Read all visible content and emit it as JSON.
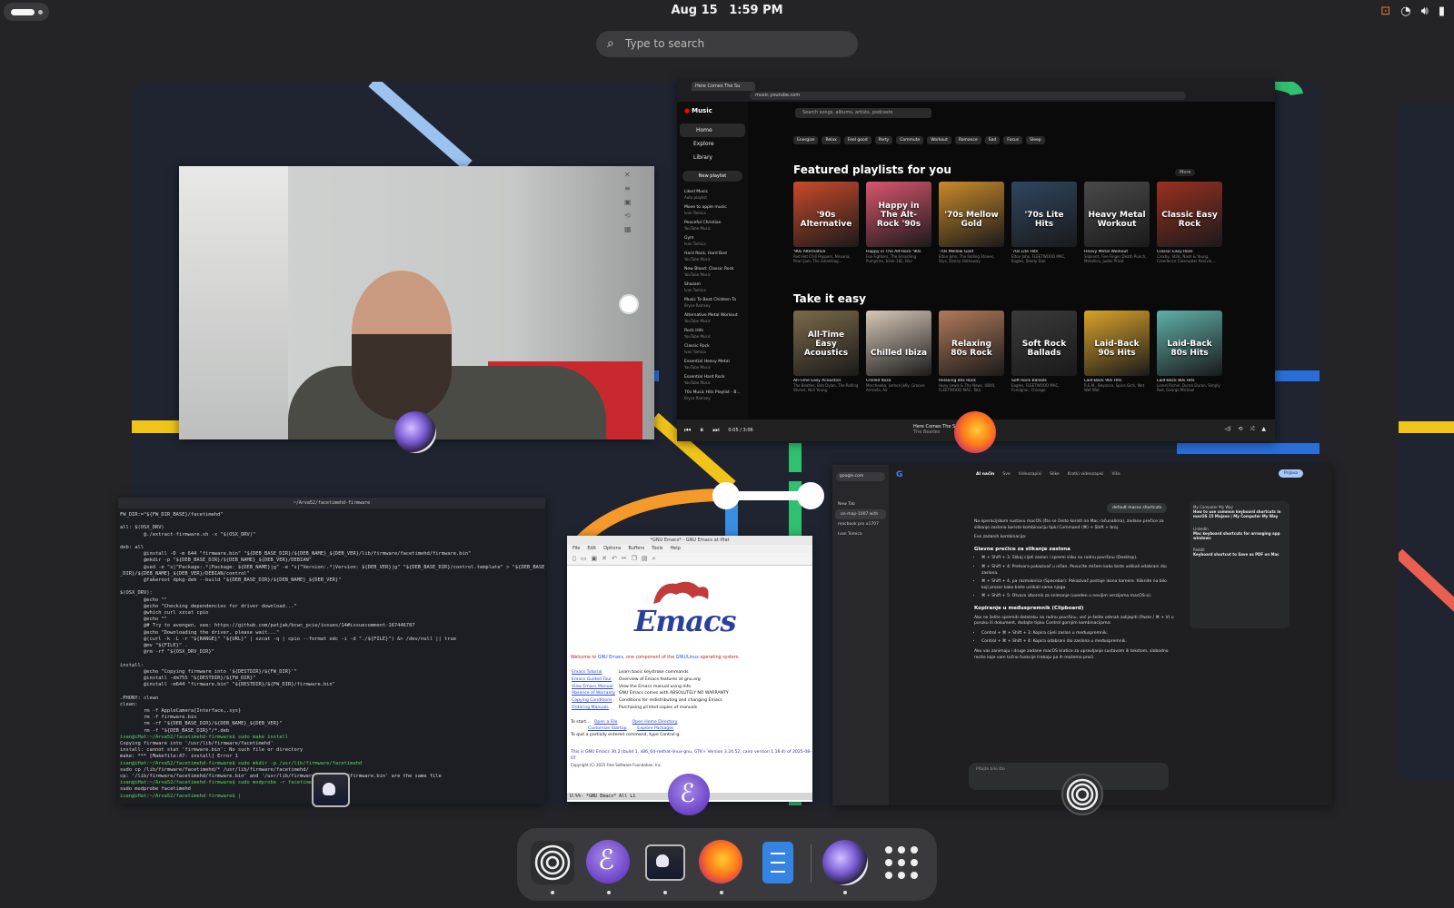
{
  "topbar": {
    "date": "Aug 15",
    "time": "1:59 PM"
  },
  "search": {
    "placeholder": "Type to search"
  },
  "windows": {
    "youtube_music": {
      "tab_title": "Here Comes The Su",
      "url": "music.youtube.com",
      "nav": [
        "Home",
        "Explore",
        "Library"
      ],
      "new_playlist": "New playlist",
      "playlists": [
        {
          "name": "Liked Music",
          "sub": "Auto playlist"
        },
        {
          "name": "Move to apple music",
          "sub": "Ivan Tomica"
        },
        {
          "name": "Peaceful Christian",
          "sub": "YouTube Music"
        },
        {
          "name": "Gym",
          "sub": "Ivan Tomica"
        },
        {
          "name": "Hard Rock, Hard Bod",
          "sub": "YouTube Music"
        },
        {
          "name": "New Blood: Classic Rock",
          "sub": "YouTube Music"
        },
        {
          "name": "Shazam",
          "sub": "Ivan Tomica"
        },
        {
          "name": "Music To Beat Children To",
          "sub": "Bryce Ramsey"
        },
        {
          "name": "Alternative Metal Workout",
          "sub": "YouTube Music"
        },
        {
          "name": "Rock Hits",
          "sub": "YouTube Music"
        },
        {
          "name": "Classic Rock",
          "sub": "Ivan Tomica"
        },
        {
          "name": "Essential Heavy Metal",
          "sub": "YouTube Music"
        },
        {
          "name": "Essential Hard Rock",
          "sub": "YouTube Music"
        },
        {
          "name": "70s Music Hits Playlist - B...",
          "sub": "Bryce Ramsey"
        }
      ],
      "search_placeholder": "Search songs, albums, artists, podcasts",
      "moods": [
        "Energize",
        "Relax",
        "Feel good",
        "Party",
        "Commute",
        "Workout",
        "Romance",
        "Sad",
        "Focus",
        "Sleep"
      ],
      "section1_title": "Featured playlists for you",
      "more_label": "More",
      "featured": [
        {
          "art": "'90s Alternative",
          "title": "'90s Alternative",
          "sub": "Red Hot Chili Peppers, Nirvana, Pearl Jam, The Smashing...",
          "color": "#c94a2a"
        },
        {
          "art": "Happy in The Alt-Rock '90s",
          "title": "Happy in The Alt-Rock '90s",
          "sub": "Foo Fighters, The Smashing Pumpkins, blink-182, Blur",
          "color": "#d9566e"
        },
        {
          "art": "'70s Mellow Gold",
          "title": "'70s Mellow Gold",
          "sub": "Elton John, The Rolling Stones, Styx, Donny Hathaway",
          "color": "#c98a2a"
        },
        {
          "art": "'70s Lite Hits",
          "title": "'70s Lite Hits",
          "sub": "Elton John, FLEETWOOD MAC, Eagles, Steely Dan",
          "color": "#2f4660"
        },
        {
          "art": "Heavy Metal Workout",
          "title": "Heavy Metal Workout",
          "sub": "Slipknot, Five Finger Death Punch, Metallica, Judas Priest",
          "color": "#4a4a4a"
        },
        {
          "art": "Classic Easy Rock",
          "title": "Classic Easy Rock",
          "sub": "Crosby, Stills, Nash & Young, Creedence Clearwater Revival,...",
          "color": "#9a3020"
        }
      ],
      "section2_title": "Take it easy",
      "easy": [
        {
          "art": "All-Time Easy Acoustics",
          "title": "All-Time Easy Acoustics",
          "sub": "The Beatles, Bob Dylan, The Rolling Stones, Neil Young",
          "color": "#7a6a4a"
        },
        {
          "art": "Chilled Ibiza",
          "title": "Chilled Ibiza",
          "sub": "Morcheeba, Lemon Jelly, Groove Armada, Air",
          "color": "#d8c8b8"
        },
        {
          "art": "Relaxing 80s Rock",
          "title": "Relaxing 80s Rock",
          "sub": "Huey Lewis & The News, UB40, FLEETWOOD MAC, Toto",
          "color": "#b07a5a"
        },
        {
          "art": "Soft Rock Ballads",
          "title": "Soft Rock Ballads",
          "sub": "Eagles, FLEETWOOD MAC, Foreigner, Chicago",
          "color": "#3a3a3a"
        },
        {
          "art": "Laid-Back 90s Hits",
          "title": "Laid-Back 90s Hits",
          "sub": "R.E.M., Beyonce, Spice Girls, Wet Wet Wet",
          "color": "#d9a32a"
        },
        {
          "art": "Laid-Back 80s Hits",
          "title": "Laid-Back 80s Hits",
          "sub": "Lionel Richie, Duran Duran, Simply Red, George Michael",
          "color": "#5fb0a8"
        }
      ],
      "now_playing_title": "Here Comes The Sun",
      "now_playing_artist": "The Beatles",
      "time": "0:05 / 3:06"
    },
    "terminal": {
      "title": "~/Arva52/facetimehd-firmware",
      "lines": [
        "FW_DIR:=\"${FW_DIR_BASE}/facetimehd\"",
        "",
        "all: $(OSX_DRV)",
        "        @./extract-firmware.sh -x \"$(OSX_DRV)\"",
        "",
        "deb: all",
        "        @install -D -m 644 \"firmware.bin\" \"${DEB_BASE_DIR}/${DEB_NAME}_${DEB_VER}/lib/firmware/facetimehd/firmware.bin\"",
        "        @mkdir -p \"${DEB_BASE_DIR}/${DEB_NAME}_${DEB_VER}/DEBIAN\"",
        "        @sed -e \"s|^Package:.*|Package: ${DEB_NAME}|g\" -e \"s|^Version:.*|Version: ${DEB_VER}|g\" \"${DEB_BASE_DIR}/control.template\" > \"${DEB_BASE",
        "_DIR}/${DEB_NAME}_${DEB_VER}/DEBIAN/control\"",
        "        @fakeroot dpkg-deb --build \"${DEB_BASE_DIR}/${DEB_NAME}_${DEB_VER}\"",
        "",
        "$(OSX_DRV):",
        "        @echo \"\"",
        "        @echo \"Checking dependencies for driver download...\"",
        "        @which curl xzcat cpio",
        "        @echo \"\"",
        "        @# Try to avengen, see: https://github.com/patjak/bcwc_pcie/issues/14#issuecomment-167446787",
        "        @echo \"Downloading the driver, please wait...\"",
        "        @(curl -k -L -r \"${RANGE}\" \"${URL}\" | xzcat -q | cpio --format odc -i -d \"./${FILE}\") &> /dev/null || true",
        "        @mv \"${FILE}\" .",
        "        @rm -rf \"${OSX_DRV_DIR}\"",
        "",
        "install:",
        "        @echo \"Copying firmware into '${DESTDIR}/${FW_DIR}'\"",
        "        @install -dm755 \"${DESTDIR}/${FW_DIR}\"",
        "        @install -m644 \"firmware.bin\" \"${DESTDIR}/${FW_DIR}/firmware.bin\"",
        "",
        ".PHONY: clean",
        "clean:",
        "        rm -f AppleCamera{Interface,.sys}",
        "        rm -f firmware.bin",
        "        rm -rf \"${DEB_BASE_DIR}/${DEB_NAME}_${DEB_VER}\"",
        "        rm -f \"${DEB_BASE_DIR}\"/*.deb",
        "ivan@iHat:~/Arva52/facetimehd-firmware$ sudo make install",
        "Copying firmware into '/usr/lib/firmware/facetimehd'",
        "install: cannot stat 'firmware.bin': No such file or directory",
        "make: *** [Makefile:47: install] Error 1",
        "ivan@iHat:~/Arva52/facetimehd-firmware$ sudo mkdir -p /usr/lib/firmware/facetimehd",
        "sudo cp /lib/firmware/facetimehd/* /usr/lib/firmware/facetimehd/",
        "cp: '/lib/firmware/facetimehd/firmware.bin' and '/usr/lib/firmware/facetimehd/firmware.bin' are the same file",
        "ivan@iHat:~/Arva52/facetimehd-firmware$ sudo modprobe -r facetimehd",
        "sudo modprobe facetimehd",
        "ivan@iHat:~/Arva52/facetimehd-firmware$ |"
      ]
    },
    "emacs": {
      "title": "*GNU Emacs* - GNU Emacs at iHat",
      "menu": [
        "File",
        "Edit",
        "Options",
        "Buffers",
        "Tools",
        "Help"
      ],
      "logo_word": "Emacs",
      "welcome_pre": "Welcome to ",
      "welcome_link1": "GNU Emacs",
      "welcome_mid": ", one component of the ",
      "welcome_link2": "GNU/Linux",
      "welcome_post": " operating system.",
      "links": [
        {
          "link": "Emacs Tutorial",
          "desc": "Learn basic keystroke commands"
        },
        {
          "link": "Emacs Guided Tour",
          "desc": "Overview of Emacs features at gnu.org"
        },
        {
          "link": "View Emacs Manual",
          "desc": "View the Emacs manual using Info"
        },
        {
          "link": "Absence of Warranty",
          "desc": "GNU Emacs comes with ABSOLUTELY NO WARRANTY"
        },
        {
          "link": "Copying Conditions",
          "desc": "Conditions for redistributing and changing Emacs"
        },
        {
          "link": "Ordering Manuals",
          "desc": "Purchasing printed copies of manuals"
        }
      ],
      "to_start": "To start...",
      "open_file": "Open a File",
      "open_home": "Open Home Directory",
      "customize": "Customize Startup",
      "explore": "Explore Packages",
      "quit_hint": "To quit a partially entered command, type Control-g.",
      "version": "This is GNU Emacs 30.2 (build 1, x86_64-redhat-linux-gnu, GTK+ Version 3.24.52, cairo version 1.18.4) of 2025-08-07",
      "copyright": "Copyright (C) 2025 Free Software Foundation, Inc.",
      "modeline": "U:%%-  *GNU Emacs*   All  L1"
    },
    "google": {
      "sidebar_url": "google.com",
      "sidebar_items": [
        "New Tab",
        "on-map-1007 with",
        "macbook pro a1707",
        "Ivan Tomica"
      ],
      "tabs": [
        "AI način",
        "Sve",
        "Videozapisi",
        "Slike",
        "Kratki videozapisi",
        "Više"
      ],
      "signin": "Prijava",
      "query": "default macos shortcuts",
      "intro": "Na operacijskom sustavu macOS (što se često koristi na Mac računalima), zadane prečice za slikanje zaslona koriste kombinaciju tipki Command (⌘) + Shift + broj.",
      "subline": "Evo zadanih kombinacija:",
      "h1": "Glavne prečice za slikanje zaslona",
      "bullets1": [
        "⌘ + Shift + 3: Slikaj cijeli zaslon i spremi sliku na radnu površinu (Desktop).",
        "⌘ + Shift + 4: Pretvara pokazivač u nišan. Povucite mišem kako biste uslikali odabrani dio zaslona.",
        "⌘ + Shift + 4, pa razmaknica (Spacebar): Pokazivač postaje ikona kamere. Kliknite na bilo koji prozor kako biste uslikali samo njega.",
        "⌘ + Shift + 5: Otvara izbornik za snimanje (uveden u novijim verzijama macOS-a)."
      ],
      "h2": "Kopiranje u međuspremnik (Clipboard)",
      "clip_intro": "Ako ne želite spremiti datoteku na radnu površinu, već je želite odmah zalijepiti (Paste / ⌘ + V) u poruku ili dokument, dodajte tipku Control gornjim kombinacijama:",
      "bullets2": [
        "Control + ⌘ + Shift + 3: Kopira cijeli zaslon u međuspremnik.",
        "Control + ⌘ + Shift + 4: Kopira odabrani dio zaslona u međuspremnik."
      ],
      "outro": "Ako vas zanimaju i druge zadane macOS kratice za upravljanje sustavom ili tekstom, slobodno recite koje vam točno funkcije trebaju pa ih možemo proći.",
      "ask_placeholder": "Pitajte bilo što",
      "sources": [
        {
          "site": "My Computer My Way",
          "title": "How to use common keyboard shortcuts in macOS 15 Mojave | My Computer My Way"
        },
        {
          "site": "LinkedIn",
          "title": "Mac keyboard shortcuts for arranging app windows"
        },
        {
          "site": "Reddit",
          "title": "Keyboard shortcut to Save as PDF on Mac"
        }
      ]
    }
  },
  "dock": {
    "apps": [
      "settings-app",
      "emacs",
      "terminal",
      "firefox",
      "text-editor",
      "camera",
      "app-grid"
    ]
  }
}
